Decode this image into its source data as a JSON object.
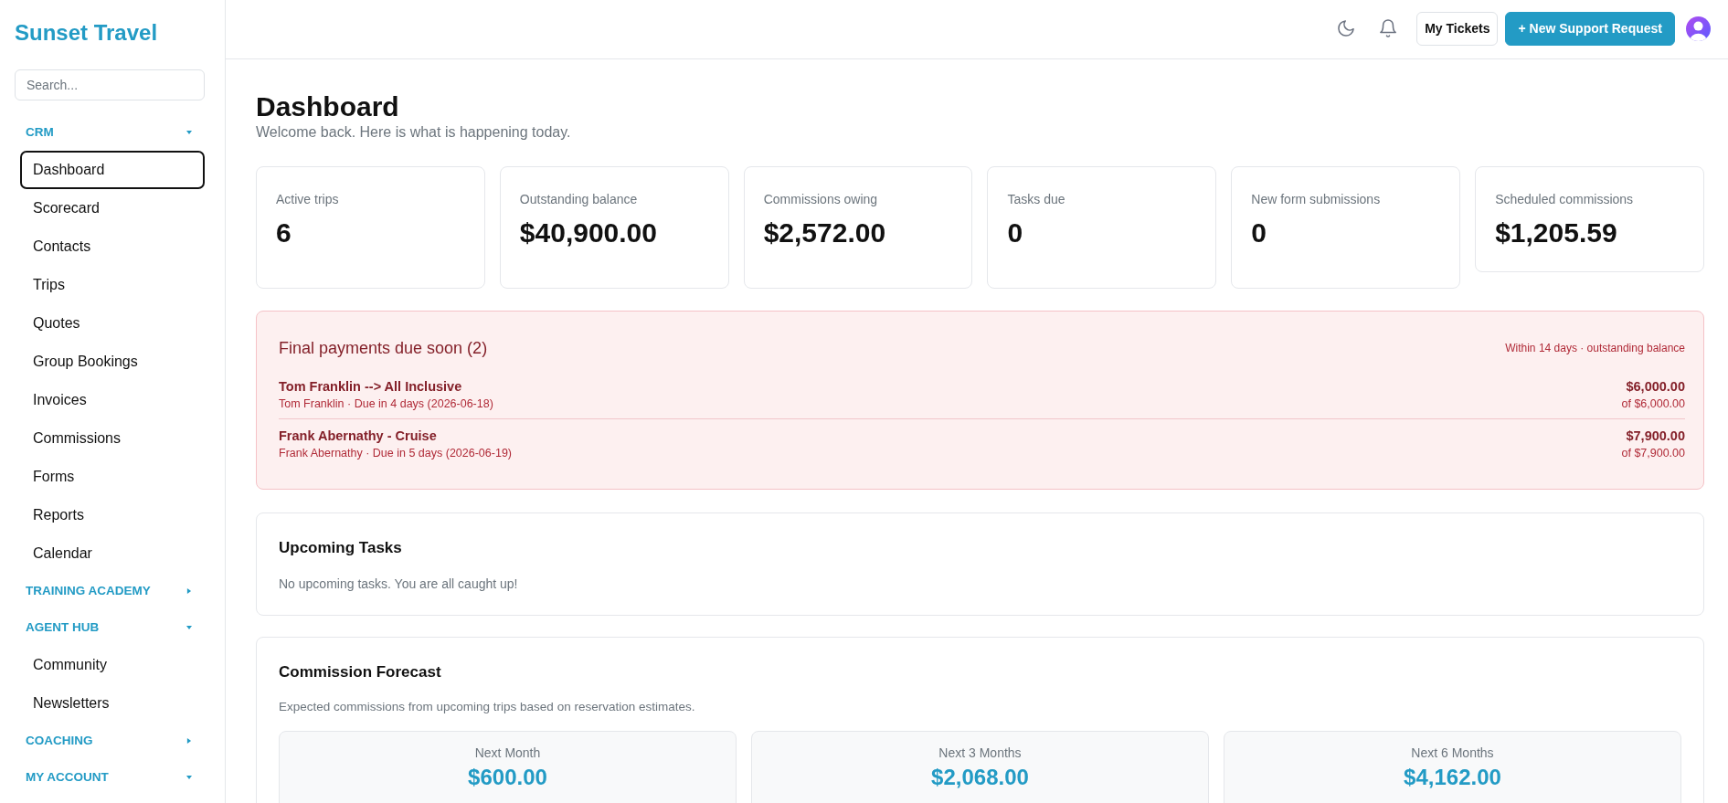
{
  "brand": {
    "name": "Sunset Travel"
  },
  "sidebar": {
    "search": {
      "placeholder": "Search..."
    },
    "sections": [
      {
        "label": "CRM",
        "expanded": true,
        "items": [
          {
            "label": "Dashboard",
            "selected": true
          },
          {
            "label": "Scorecard",
            "selected": false
          },
          {
            "label": "Contacts",
            "selected": false
          },
          {
            "label": "Trips",
            "selected": false
          },
          {
            "label": "Quotes",
            "selected": false
          },
          {
            "label": "Group Bookings",
            "selected": false
          },
          {
            "label": "Invoices",
            "selected": false
          },
          {
            "label": "Commissions",
            "selected": false
          },
          {
            "label": "Forms",
            "selected": false
          },
          {
            "label": "Reports",
            "selected": false
          },
          {
            "label": "Calendar",
            "selected": false
          }
        ]
      },
      {
        "label": "TRAINING ACADEMY",
        "expanded": false
      },
      {
        "label": "AGENT HUB",
        "expanded": true,
        "items": [
          {
            "label": "Community",
            "selected": false
          },
          {
            "label": "Newsletters",
            "selected": false
          }
        ]
      },
      {
        "label": "COACHING",
        "expanded": false
      },
      {
        "label": "MY ACCOUNT",
        "expanded": true
      }
    ]
  },
  "topbar": {
    "buttons": [
      {
        "label": "My Tickets",
        "kind": "outline"
      },
      {
        "label": "+ New Support Request",
        "kind": "primary"
      }
    ]
  },
  "page": {
    "title": "Dashboard",
    "subtitle": "Welcome back. Here is what is happening today."
  },
  "stats": [
    {
      "label": "Active trips",
      "value": "6"
    },
    {
      "label": "Outstanding balance",
      "value": "$40,900.00"
    },
    {
      "label": "Commissions owing",
      "value": "$2,572.00"
    },
    {
      "label": "Tasks due",
      "value": "0"
    },
    {
      "label": "New form submissions",
      "value": "0"
    },
    {
      "label": "Scheduled commissions",
      "value": "$1,205.59"
    }
  ],
  "payments_due": {
    "title": "Final payments due soon (2)",
    "note": "Within 14 days · outstanding balance",
    "rows": [
      {
        "title": "Tom Franklin --> All Inclusive",
        "detail": "Tom Franklin · Due in 4 days (2026-06-18)",
        "amount": "$6,000.00",
        "total": "of $6,000.00"
      },
      {
        "title": "Frank Abernathy - Cruise",
        "detail": "Frank Abernathy · Due in 5 days (2026-06-19)",
        "amount": "$7,900.00",
        "total": "of $7,900.00"
      }
    ]
  },
  "upcoming_tasks": {
    "title": "Upcoming Tasks",
    "empty_text": "No upcoming tasks. You are all caught up!"
  },
  "commission_forecast": {
    "title": "Commission Forecast",
    "description": "Expected commissions from upcoming trips based on reservation estimates.",
    "periods": [
      {
        "label": "Next Month",
        "value": "$600.00"
      },
      {
        "label": "Next 3 Months",
        "value": "$2,068.00"
      },
      {
        "label": "Next 6 Months",
        "value": "$4,162.00"
      }
    ]
  }
}
